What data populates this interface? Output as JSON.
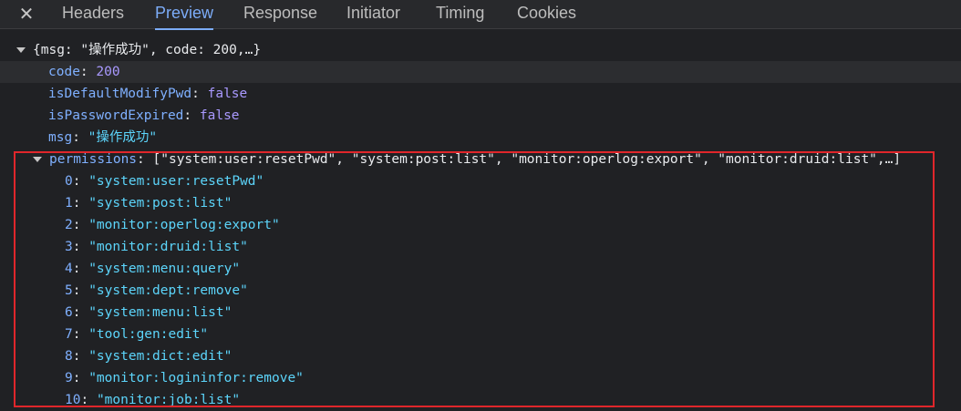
{
  "tabs": {
    "close_glyph": "✕",
    "items": [
      "Headers",
      "Preview",
      "Response",
      "Initiator",
      "Timing",
      "Cookies"
    ],
    "active": "Preview"
  },
  "root_summary": "{msg: \"操作成功\", code: 200,…}",
  "fields": {
    "code": {
      "key": "code",
      "value": "200"
    },
    "isDefaultModifyPwd": {
      "key": "isDefaultModifyPwd",
      "value": "false"
    },
    "isPasswordExpired": {
      "key": "isPasswordExpired",
      "value": "false"
    },
    "msg": {
      "key": "msg",
      "value": "\"操作成功\""
    }
  },
  "permissions": {
    "key": "permissions",
    "summary": "[\"system:user:resetPwd\", \"system:post:list\", \"monitor:operlog:export\", \"monitor:druid:list\",…]",
    "items": [
      {
        "index": "0",
        "value": "\"system:user:resetPwd\""
      },
      {
        "index": "1",
        "value": "\"system:post:list\""
      },
      {
        "index": "2",
        "value": "\"monitor:operlog:export\""
      },
      {
        "index": "3",
        "value": "\"monitor:druid:list\""
      },
      {
        "index": "4",
        "value": "\"system:menu:query\""
      },
      {
        "index": "5",
        "value": "\"system:dept:remove\""
      },
      {
        "index": "6",
        "value": "\"system:menu:list\""
      },
      {
        "index": "7",
        "value": "\"tool:gen:edit\""
      },
      {
        "index": "8",
        "value": "\"system:dict:edit\""
      },
      {
        "index": "9",
        "value": "\"monitor:logininfor:remove\""
      },
      {
        "index": "10",
        "value": "\"monitor:job:list\""
      }
    ]
  },
  "colors": {
    "background": "#202124",
    "accent_tab": "#7cacf8",
    "key": "#7fb0ff",
    "string": "#5cd5fb",
    "number_bool": "#a999ff",
    "highlight_box": "#e0262b"
  }
}
